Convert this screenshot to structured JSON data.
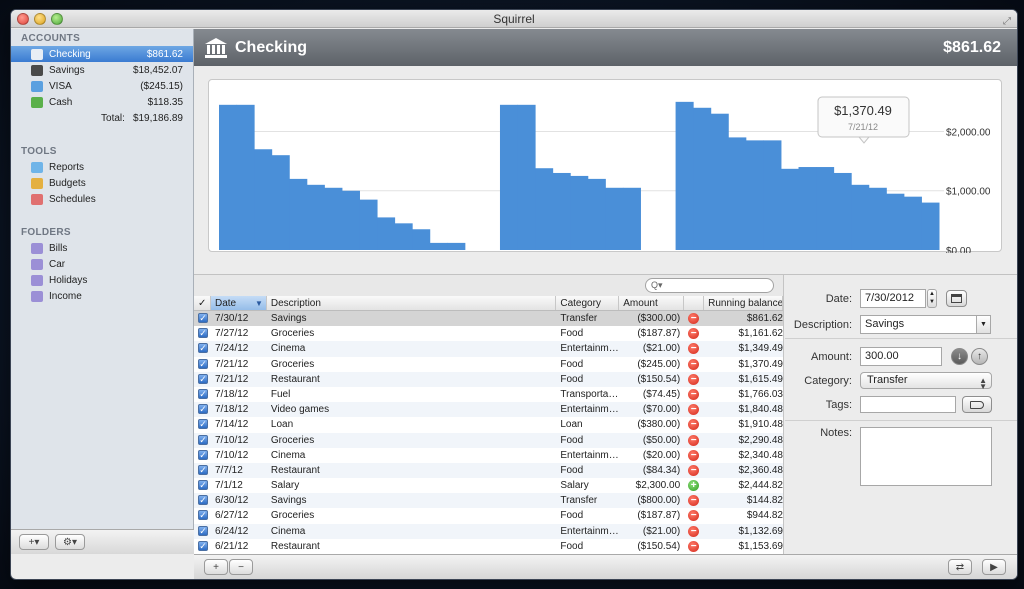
{
  "window": {
    "title": "Squirrel"
  },
  "sidebar": {
    "accounts_heading": "ACCOUNTS",
    "accounts": [
      {
        "icon": "bank-icon",
        "name": "Checking",
        "amount": "$861.62",
        "selected": true
      },
      {
        "icon": "safe-icon",
        "name": "Savings",
        "amount": "$18,452.07"
      },
      {
        "icon": "credit-card-icon",
        "name": "VISA",
        "amount": "($245.15)"
      },
      {
        "icon": "cash-icon",
        "name": "Cash",
        "amount": "$118.35"
      }
    ],
    "total_label": "Total:",
    "total_amount": "$19,186.89",
    "tools_heading": "TOOLS",
    "tools": [
      {
        "icon": "pie-chart-icon",
        "name": "Reports"
      },
      {
        "icon": "budget-icon",
        "name": "Budgets"
      },
      {
        "icon": "calendar-icon",
        "name": "Schedules"
      }
    ],
    "folders_heading": "FOLDERS",
    "folders": [
      {
        "icon": "folder-icon",
        "name": "Bills"
      },
      {
        "icon": "folder-icon",
        "name": "Car"
      },
      {
        "icon": "folder-icon",
        "name": "Holidays"
      },
      {
        "icon": "folder-icon",
        "name": "Income"
      }
    ],
    "add_button": "+▾",
    "gear_button": "⚙▾"
  },
  "header": {
    "title": "Checking",
    "balance": "$861.62"
  },
  "chart_data": {
    "type": "area",
    "y_ticks": [
      "$2,000.00",
      "$1,000.00",
      "$0.00"
    ],
    "ylim": [
      0,
      2700
    ],
    "values": [
      2450,
      2450,
      1700,
      1600,
      1200,
      1100,
      1050,
      1000,
      850,
      550,
      450,
      350,
      120,
      120,
      120,
      2450,
      2450,
      2450,
      1380,
      1300,
      1250,
      1200,
      1050,
      1050,
      1000,
      2500,
      2500,
      2400,
      2300,
      1900,
      1850,
      1850,
      1370,
      1400,
      1400,
      1300,
      1100,
      1050,
      950,
      900,
      800
    ],
    "gaps": [
      14,
      15,
      24,
      25
    ],
    "color": "#4a8fd8",
    "tooltip": {
      "value": "$1,370.49",
      "date": "7/21/12"
    }
  },
  "table": {
    "search_placeholder": "Q▾",
    "columns": [
      "✓",
      "Date",
      "Description",
      "Category",
      "Amount",
      "",
      "Running balance"
    ],
    "rows": [
      {
        "date": "7/30/12",
        "desc": "Savings",
        "cat": "Transfer",
        "amt": "($300.00)",
        "dir": "out",
        "bal": "$861.62",
        "sel": true
      },
      {
        "date": "7/27/12",
        "desc": "Groceries",
        "cat": "Food",
        "amt": "($187.87)",
        "dir": "out",
        "bal": "$1,161.62"
      },
      {
        "date": "7/24/12",
        "desc": "Cinema",
        "cat": "Entertainm…",
        "amt": "($21.00)",
        "dir": "out",
        "bal": "$1,349.49"
      },
      {
        "date": "7/21/12",
        "desc": "Groceries",
        "cat": "Food",
        "amt": "($245.00)",
        "dir": "out",
        "bal": "$1,370.49"
      },
      {
        "date": "7/21/12",
        "desc": "Restaurant",
        "cat": "Food",
        "amt": "($150.54)",
        "dir": "out",
        "bal": "$1,615.49"
      },
      {
        "date": "7/18/12",
        "desc": "Fuel",
        "cat": "Transporta…",
        "amt": "($74.45)",
        "dir": "out",
        "bal": "$1,766.03"
      },
      {
        "date": "7/18/12",
        "desc": "Video games",
        "cat": "Entertainm…",
        "amt": "($70.00)",
        "dir": "out",
        "bal": "$1,840.48"
      },
      {
        "date": "7/14/12",
        "desc": "Loan",
        "cat": "Loan",
        "amt": "($380.00)",
        "dir": "out",
        "bal": "$1,910.48"
      },
      {
        "date": "7/10/12",
        "desc": "Groceries",
        "cat": "Food",
        "amt": "($50.00)",
        "dir": "out",
        "bal": "$2,290.48"
      },
      {
        "date": "7/10/12",
        "desc": "Cinema",
        "cat": "Entertainm…",
        "amt": "($20.00)",
        "dir": "out",
        "bal": "$2,340.48"
      },
      {
        "date": "7/7/12",
        "desc": "Restaurant",
        "cat": "Food",
        "amt": "($84.34)",
        "dir": "out",
        "bal": "$2,360.48"
      },
      {
        "date": "7/1/12",
        "desc": "Salary",
        "cat": "Salary",
        "amt": "$2,300.00",
        "dir": "in",
        "bal": "$2,444.82"
      },
      {
        "date": "6/30/12",
        "desc": "Savings",
        "cat": "Transfer",
        "amt": "($800.00)",
        "dir": "out",
        "bal": "$144.82"
      },
      {
        "date": "6/27/12",
        "desc": "Groceries",
        "cat": "Food",
        "amt": "($187.87)",
        "dir": "out",
        "bal": "$944.82"
      },
      {
        "date": "6/24/12",
        "desc": "Cinema",
        "cat": "Entertainm…",
        "amt": "($21.00)",
        "dir": "out",
        "bal": "$1,132.69"
      },
      {
        "date": "6/21/12",
        "desc": "Restaurant",
        "cat": "Food",
        "amt": "($150.54)",
        "dir": "out",
        "bal": "$1,153.69"
      }
    ]
  },
  "form": {
    "date_label": "Date:",
    "date_value": "7/30/2012",
    "description_label": "Description:",
    "description_value": "Savings",
    "amount_label": "Amount:",
    "amount_value": "300.00",
    "category_label": "Category:",
    "category_value": "Transfer",
    "tags_label": "Tags:",
    "tags_value": "",
    "notes_label": "Notes:",
    "notes_value": ""
  },
  "bottombar": {
    "add": "+",
    "remove": "−"
  }
}
